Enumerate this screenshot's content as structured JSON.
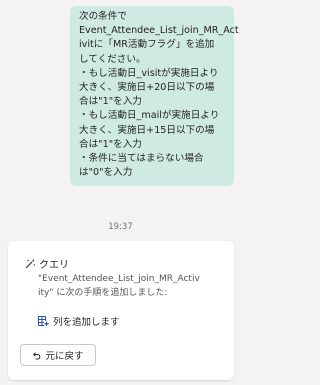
{
  "user_message": {
    "lines": [
      "次の条件で",
      "Event_Attendee_List_join_MR_Act",
      "ivitに「MR活動フラグ」を追加",
      "してください。",
      "・もし活動日_visitが実施日より",
      "大きく、実施日+20日以下の場",
      "合は\"1\"を入力",
      "・もし活動日_mailが実施日より",
      "大きく、実施日+15日以下の場",
      "合は\"1\"を入力",
      "・条件に当てはまらない場合",
      "は\"0\"を入力"
    ]
  },
  "timestamp": "19:37",
  "response_card": {
    "title": "クエリ",
    "title_icon": "magic-wand-icon",
    "description_lines": [
      "\"Event_Attendee_List_join_MR_Activ",
      "ity\" に次の手順を追加しました:"
    ],
    "step_icon": "add-column-icon",
    "step_label": "列を追加します",
    "undo_icon": "undo-icon",
    "undo_label": "元に戻す"
  }
}
